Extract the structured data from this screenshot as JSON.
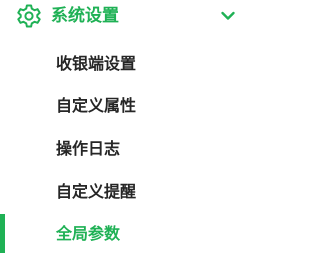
{
  "menu": {
    "group": {
      "title": "系统设置",
      "icon": "gear-icon",
      "toggle_icon": "chevron-down-icon",
      "expanded": true
    },
    "items": [
      {
        "label": "收银端设置",
        "active": false
      },
      {
        "label": "自定义属性",
        "active": false
      },
      {
        "label": "操作日志",
        "active": false
      },
      {
        "label": "自定义提醒",
        "active": false
      },
      {
        "label": "全局参数",
        "active": true
      }
    ]
  },
  "colors": {
    "accent": "#1fb155",
    "text": "#262626",
    "background": "#ffffff"
  }
}
